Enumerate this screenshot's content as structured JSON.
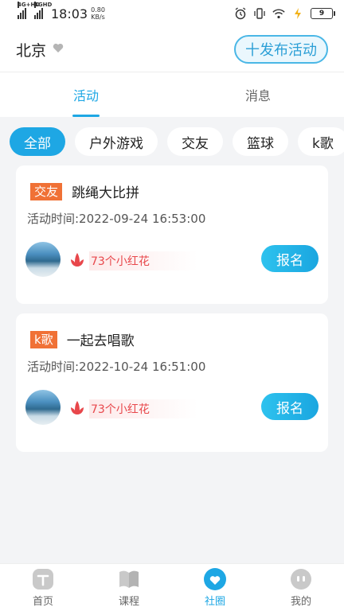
{
  "status_bar": {
    "net1": "4G+HD",
    "net2": "4GHD",
    "time": "18:03",
    "speed_value": "0.80",
    "speed_unit": "KB/s",
    "battery": "9"
  },
  "header": {
    "city": "北京",
    "publish_label": "十发布活动"
  },
  "tabs": [
    {
      "label": "活动",
      "active": true
    },
    {
      "label": "消息",
      "active": false
    }
  ],
  "filters": [
    "全部",
    "户外游戏",
    "交友",
    "篮球",
    "k歌"
  ],
  "cards": [
    {
      "category": "交友",
      "title": "跳绳大比拼",
      "time": "活动时间:2022-09-24 16:53:00",
      "flowers": "73个小红花",
      "button": "报名"
    },
    {
      "category": "k歌",
      "title": "一起去唱歌",
      "time": "活动时间:2022-10-24 16:51:00",
      "flowers": "73个小红花",
      "button": "报名"
    }
  ],
  "bottom_nav": [
    {
      "label": "首页",
      "icon": "home-icon"
    },
    {
      "label": "课程",
      "icon": "book-icon"
    },
    {
      "label": "社圈",
      "icon": "heart-icon",
      "active": true
    },
    {
      "label": "我的",
      "icon": "profile-icon"
    }
  ],
  "colors": {
    "accent": "#1ea7e4",
    "badge": "#f07136",
    "flower": "#e8474b"
  }
}
